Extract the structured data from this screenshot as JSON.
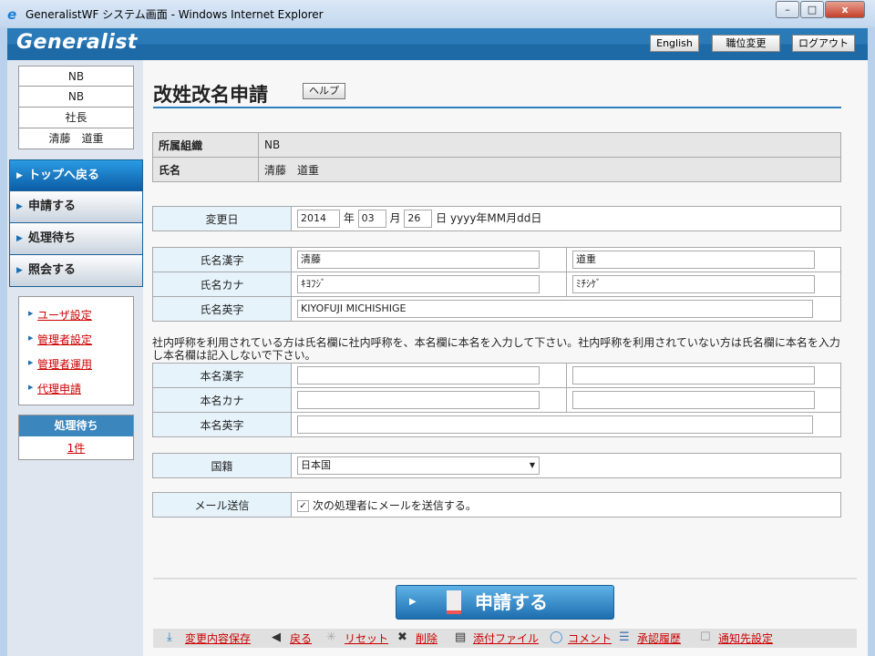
{
  "window": {
    "title": "GeneralistWF システム画面 - Windows Internet Explorer"
  },
  "header": {
    "logo": "Generalist",
    "english": "English",
    "position_change": "職位変更",
    "logout": "ログアウト"
  },
  "user_info": [
    "NB",
    "NB",
    "社長",
    "清藤　道重"
  ],
  "nav": [
    "トップへ戻る",
    "申請する",
    "処理待ち",
    "照会する"
  ],
  "links": [
    "ユーザ設定",
    "管理者設定",
    "管理者運用",
    "代理申請"
  ],
  "pending": {
    "title": "処理待ち",
    "count": "1件"
  },
  "page": {
    "title": "改姓改名申請",
    "help": "ヘルプ"
  },
  "info": {
    "org_label": "所属組織",
    "org": "NB",
    "name_label": "氏名",
    "name": "清藤　道重"
  },
  "date": {
    "label": "変更日",
    "year": "2014",
    "year_unit": "年",
    "month": "03",
    "month_unit": "月",
    "day": "26",
    "day_unit": "日",
    "format": "yyyy年MM月dd日"
  },
  "name": {
    "kanji_label": "氏名漢字",
    "kanji_last": "清藤",
    "kanji_first": "道重",
    "kana_label": "氏名カナ",
    "kana_last": "ｷﾖﾌｼﾞ",
    "kana_first": "ﾐﾁｼｹﾞ",
    "eng_label": "氏名英字",
    "eng": "KIYOFUJI MICHISHIGE"
  },
  "note": "社内呼称を利用されている方は氏名欄に社内呼称を、本名欄に本名を入力して下さい。社内呼称を利用されていない方は氏名欄に本名を入力し本名欄は記入しないで下さい。",
  "real": {
    "kanji_label": "本名漢字",
    "kana_label": "本名カナ",
    "eng_label": "本名英字"
  },
  "nationality": {
    "label": "国籍",
    "value": "日本国"
  },
  "mail": {
    "label": "メール送信",
    "text": "次の処理者にメールを送信する。",
    "checked": true
  },
  "submit": "申請する",
  "toolbar": [
    "変更内容保存",
    "戻る",
    "リセット",
    "削除",
    "添付ファイル",
    "コメント",
    "承認履歴",
    "通知先設定"
  ]
}
